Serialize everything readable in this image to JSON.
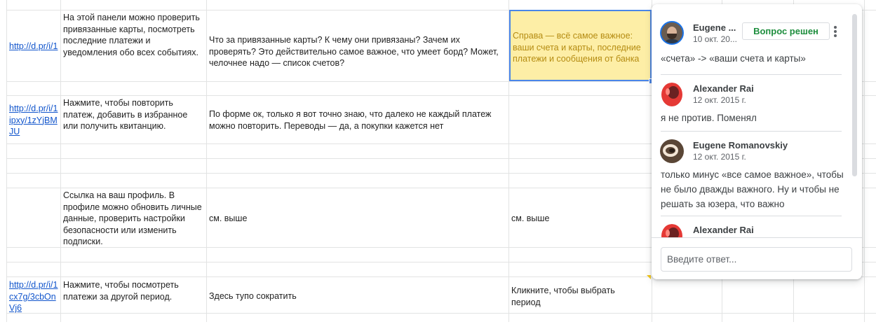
{
  "rows": [
    {
      "link": "http://d.pr/i/1",
      "col_b": "На этой панели можно проверить привязанные карты, посмотреть последние платежи и уведомления обо всех событиях.",
      "col_c": "Что за привязанные карты? К чему они привязаны? Зачем их проверять? Это действительно самое важное, что умеет борд? Может, челочнее надо — список счетов?",
      "col_d": "Справа — всё самое важное: ваши счета и карты, последние платежи и сообщения от банка"
    },
    {
      "link": "http://d.pr/i/1ipxy/1zYjBMJU",
      "col_b": "Нажмите, чтобы повторить платеж, добавить в избранное или получить квитанцию.",
      "col_c": "По форме ок, только я вот точно знаю, что далеко не каждый платеж можно повторить. Переводы — да, а покупки кажется нет",
      "col_d": ""
    },
    {
      "link": "",
      "col_b": "Ссылка на ваш профиль. В профиле можно обновить личные данные, проверить настройки безопасности или изменить подписки.",
      "col_c": "см. выше",
      "col_d": "см. выше"
    },
    {
      "link": "http://d.pr/i/1cx7g/3cbOnVj6",
      "col_b": "Нажмите, чтобы посмотреть платежи за другой период.",
      "col_c": "Здесь тупо сократить",
      "col_d": "Кликните, чтобы выбрать период"
    }
  ],
  "comments": {
    "resolve_label": "Вопрос решен",
    "reply_placeholder": "Введите ответ...",
    "thread": [
      {
        "author": "Eugene ...",
        "date": "10 окт. 20...",
        "text": "«счета» -> «ваши счета и карты»"
      },
      {
        "author": "Alexander Rai",
        "date": "12 окт. 2015 г.",
        "text": "я не против. Поменял"
      },
      {
        "author": "Eugene Romanovskiy",
        "date": "12 окт. 2015 г.",
        "text": "только минус «все самое важное», чтобы не было дважды важного. Ну и чтобы не решать за юзера, что важно"
      },
      {
        "author": "Alexander Rai",
        "date": "",
        "text": ""
      }
    ]
  },
  "colors": {
    "selected_cell_bg": "#fdeea6",
    "selected_cell_border": "#4a86e8",
    "link": "#1155cc",
    "resolve_green": "#1e8e3e"
  }
}
